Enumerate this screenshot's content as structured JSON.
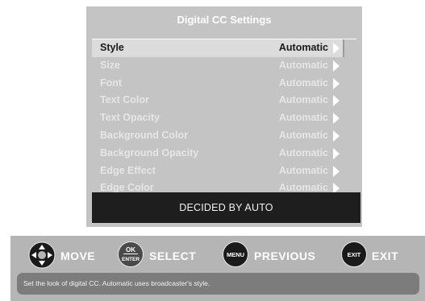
{
  "menu": {
    "title": "Digital CC Settings",
    "items": [
      {
        "label": "Style",
        "value": "Automatic",
        "selected": true
      },
      {
        "label": "Size",
        "value": "Automatic",
        "selected": false
      },
      {
        "label": "Font",
        "value": "Automatic",
        "selected": false
      },
      {
        "label": "Text Color",
        "value": "Automatic",
        "selected": false
      },
      {
        "label": "Text Opacity",
        "value": "Automatic",
        "selected": false
      },
      {
        "label": "Background Color",
        "value": "Automatic",
        "selected": false
      },
      {
        "label": "Background Opacity",
        "value": "Automatic",
        "selected": false
      },
      {
        "label": "Edge Effect",
        "value": "Automatic",
        "selected": false
      },
      {
        "label": "Edge Color",
        "value": "Automatic",
        "selected": false
      }
    ],
    "status": "DECIDED BY AUTO"
  },
  "nav": {
    "move_label": "MOVE",
    "select_label": "SELECT",
    "select_button_top": "OK",
    "select_button_bottom": "ENTER",
    "previous_label": "PREVIOUS",
    "previous_button": "MENU",
    "exit_label": "EXIT",
    "exit_button": "EXIT",
    "help_text": "Set the look of digital CC. Automatic uses broadcaster's style."
  },
  "colors": {
    "menu_bg": "#c4c4c4",
    "selected_row_bg": "#dcdcdc",
    "status_bg": "#1e1e1e",
    "nav_bg": "#b5b5b5",
    "help_bg": "#7c7c7c"
  }
}
